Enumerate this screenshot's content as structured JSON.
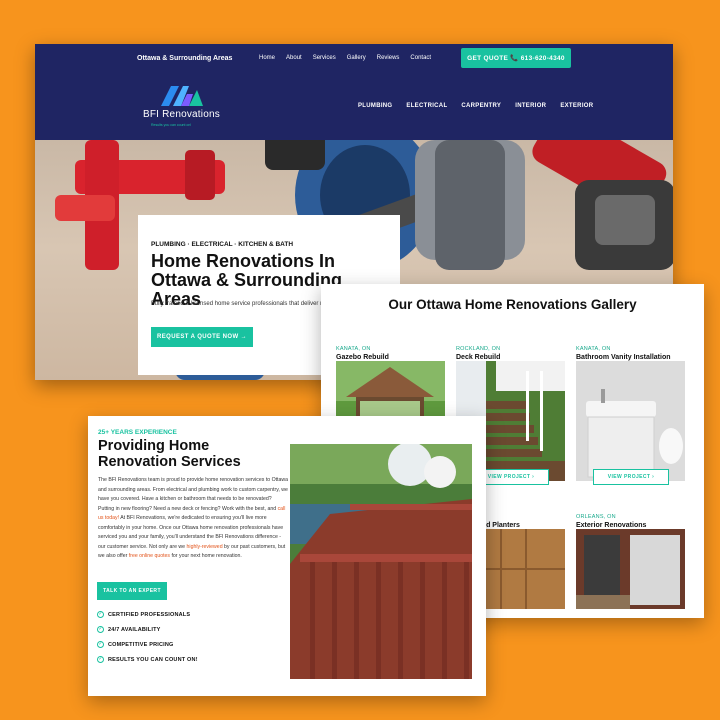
{
  "header": {
    "area_label": "Ottawa & Surrounding Areas",
    "top_nav": [
      "Home",
      "About",
      "Services",
      "Gallery",
      "Reviews",
      "Contact"
    ],
    "quote_button": "GET QUOTE 📞 613-620-4340",
    "logo_name": "BFI Renovations",
    "logo_tagline": "Results you can count on!",
    "main_nav": [
      "PLUMBING",
      "ELECTRICAL",
      "CARPENTRY",
      "INTERIOR",
      "EXTERIOR"
    ]
  },
  "hero": {
    "kicker": "PLUMBING · ELECTRICAL · KITCHEN & BATH",
    "title": "Home Renovations In Ottawa & Surrounding Areas",
    "body": "Fully trained & licensed home service professionals that deliver results you can count on!",
    "button": "REQUEST A QUOTE NOW →"
  },
  "gallery": {
    "title": "Our Ottawa Home Renovations Gallery",
    "items": [
      {
        "location": "KANATA, ON",
        "name": "Gazebo Rebuild"
      },
      {
        "location": "ROCKLAND, ON",
        "name": "Deck Rebuild"
      },
      {
        "location": "KANATA, ON",
        "name": "Bathroom Vanity Installation"
      }
    ],
    "items_row2": [
      {
        "location": "ON",
        "name": "Steps And Planters"
      },
      {
        "location": "ORLEANS, ON",
        "name": "Exterior Renovations"
      }
    ],
    "view_button": "VIEW PROJECT ›"
  },
  "services": {
    "kicker": "25+ YEARS EXPERIENCE",
    "title": "Providing Home Renovation Services",
    "body_1": "The BFI Renovations team is proud to provide home renovation services to Ottawa and surrounding areas. From electrical and plumbing work to custom carpentry, we have you covered. Have a kitchen or bathroom that needs to be renovated? Putting in new flooring? Need a new deck or fencing? Work with the best, and",
    "link_call": "call us today!",
    "body_2": " At BFI Renovations, we're dedicated to ensuring you'll live more comfortably in your home. Once our Ottawa home renovation professionals have serviced you and your family, you'll understand the BFI Renovations difference - our customer service. Not only are we",
    "link_reviewed": "highly-reviewed",
    "body_3": " by our past customers, but we also offer",
    "link_quotes": "free online quotes",
    "body_4": " for your next home renovation.",
    "button": "TALK TO AN EXPERT",
    "features": [
      "CERTIFIED PROFESSIONALS",
      "24/7 AVAILABILITY",
      "COMPETITIVE PRICING",
      "RESULTS YOU CAN COUNT ON!"
    ]
  },
  "colors": {
    "background": "#f7941d",
    "navy": "#1f2563",
    "accent": "#19c2a0",
    "link": "#e2541b"
  }
}
